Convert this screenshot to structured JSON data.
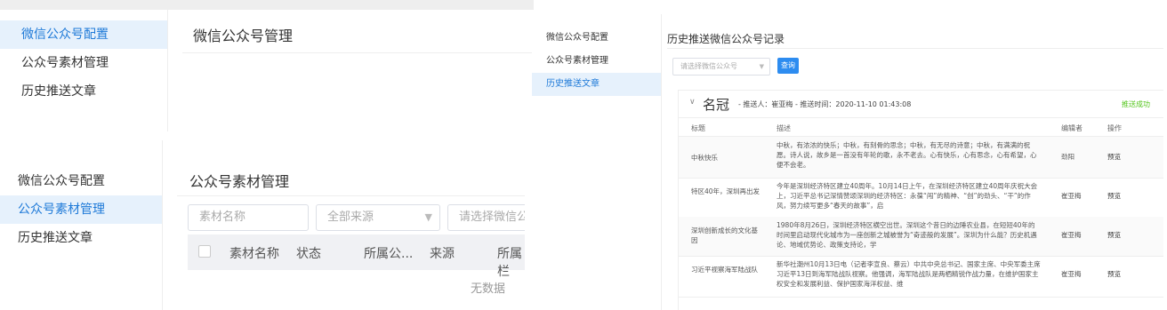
{
  "panel_a": {
    "menu": [
      "微信公众号配置",
      "公众号素材管理",
      "历史推送文章"
    ],
    "title": "微信公众号管理"
  },
  "panel_b": {
    "menu": [
      "微信公众号配置",
      "公众号素材管理",
      "历史推送文章"
    ],
    "title": "公众号素材管理",
    "filters": {
      "name_placeholder": "素材名称",
      "source_placeholder": "全部来源",
      "account_placeholder": "请选择微信公众号"
    },
    "columns": [
      "素材名称",
      "状态",
      "所属公...",
      "来源",
      "所属栏"
    ],
    "empty_text": "无数据"
  },
  "panel_c": {
    "menu": [
      "微信公众号配置",
      "公众号素材管理",
      "历史推送文章"
    ],
    "title": "历史推送微信公众号记录",
    "account_placeholder": "请选择微信公众号",
    "query_label": "查询",
    "record": {
      "name": "名冠",
      "meta": "- 推送人：崔亚梅 - 推送时间：2020-11-10 01:43:08",
      "status": "推送成功",
      "columns": [
        "标题",
        "描述",
        "编辑者",
        "操作"
      ],
      "rows": [
        {
          "title": "中秋快乐",
          "desc": "中秋，有浓浓的快乐；中秋，有刻骨的思念；中秋，有无尽的诗意；中秋，有满满的祝愿。诗人说，故乡是一首没有年轮的歌，永不老去。心有快乐，心有思念，心有希望，心便不会老。",
          "editor": "劲阳",
          "action": "预览"
        },
        {
          "title": "特区40年，深圳再出发",
          "desc": "今年是深圳经济特区建立40周年。10月14日上午，在深圳经济特区建立40周年庆祝大会上，习近平总书记深情赞颂深圳的经济特区：永葆“闯”的精神、“创”的劲头、“干”的作风，努力续写更多“春天的故事”，启",
          "editor": "崔亚梅",
          "action": "预览"
        },
        {
          "title": "深圳创新成长的文化基因",
          "desc": "1980年8月26日，深圳经济特区横空出世。深圳这个昔日的边陲农业县，在短短40年的时间里启动现代化城市为一座创新之城被誉为“奇迹般的发展”。深圳为什么能？历史机遇论、地域优势论、政策支持论，学",
          "editor": "崔亚梅",
          "action": "预览"
        },
        {
          "title": "习近平视察海军陆战队",
          "desc": "新华社潮州10月13日电（记者李宣良、蔡云）中共中央总书记、国家主席、中央军委主席习近平13日到海军陆战队视察。他强调，海军陆战队是两栖精锐作战力量，在维护国家主权安全和发展利益、保护国家海洋权益、维",
          "editor": "崔亚梅",
          "action": "预览"
        }
      ]
    }
  },
  "colors": {
    "active_bg": "#e6f1fc",
    "active_text": "#1f7ad8",
    "primary": "#2d8cf0",
    "success": "#52c41a"
  }
}
